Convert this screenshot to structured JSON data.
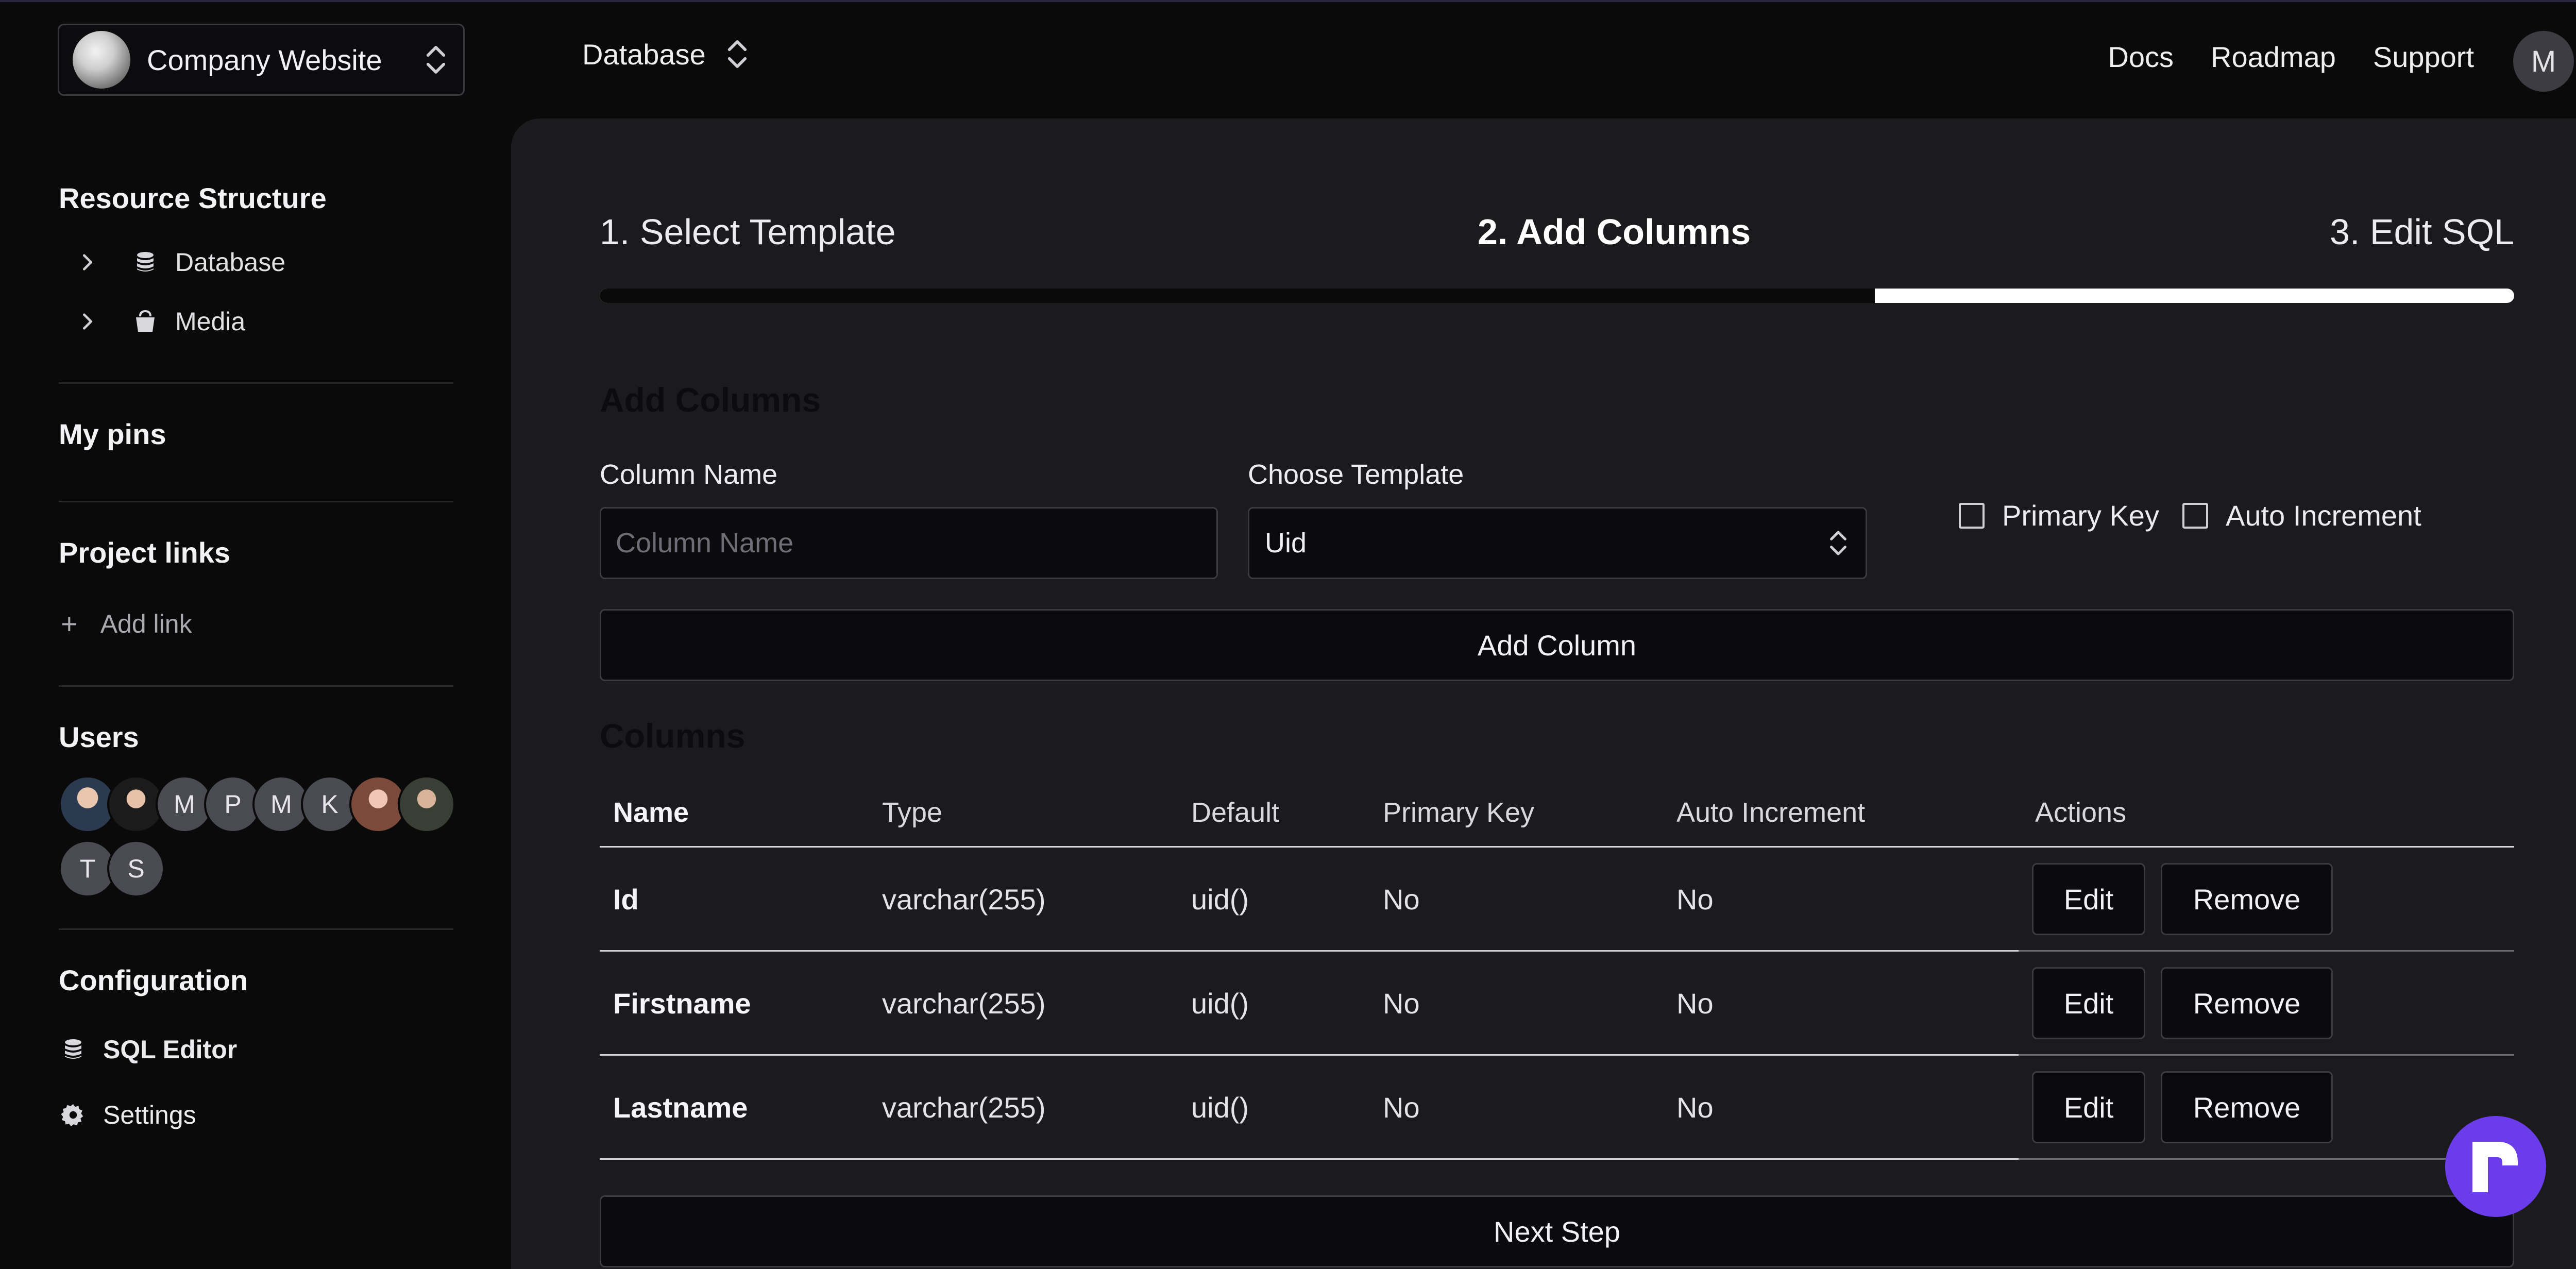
{
  "header": {
    "project_name": "Company Website",
    "database_label": "Database",
    "links": [
      "Docs",
      "Roadmap",
      "Support"
    ],
    "user_initial": "M"
  },
  "sidebar": {
    "resource_structure_title": "Resource Structure",
    "tree": [
      {
        "label": "Database",
        "icon": "database-icon"
      },
      {
        "label": "Media",
        "icon": "bucket-icon"
      }
    ],
    "my_pins_title": "My pins",
    "project_links_title": "Project links",
    "add_link_label": "Add link",
    "users_title": "Users",
    "users_row1": [
      "",
      "",
      "M",
      "P",
      "M",
      "K",
      "",
      ""
    ],
    "users_row2": [
      "T",
      "S"
    ],
    "configuration_title": "Configuration",
    "config_items": [
      {
        "label": "SQL Editor",
        "icon": "database-icon"
      },
      {
        "label": "Settings",
        "icon": "gear-icon"
      }
    ]
  },
  "wizard": {
    "steps": [
      "1. Select Template",
      "2. Add Columns",
      "3. Edit SQL"
    ],
    "active_step": 2,
    "progress_fraction": 0.666
  },
  "form": {
    "heading": "Add Columns",
    "column_name_label": "Column Name",
    "column_name_placeholder": "Column Name",
    "column_name_value": "",
    "template_label": "Choose Template",
    "template_value": "Uid",
    "primary_key_label": "Primary Key",
    "auto_increment_label": "Auto Increment",
    "add_column_button": "Add Column"
  },
  "columns_section": {
    "heading": "Columns",
    "headers": [
      "Name",
      "Type",
      "Default",
      "Primary Key",
      "Auto Increment",
      "Actions"
    ],
    "rows": [
      {
        "name": "Id",
        "type": "varchar(255)",
        "default": "uid()",
        "primary_key": "No",
        "auto_increment": "No"
      },
      {
        "name": "Firstname",
        "type": "varchar(255)",
        "default": "uid()",
        "primary_key": "No",
        "auto_increment": "No"
      },
      {
        "name": "Lastname",
        "type": "varchar(255)",
        "default": "uid()",
        "primary_key": "No",
        "auto_increment": "No"
      }
    ],
    "edit_label": "Edit",
    "remove_label": "Remove"
  },
  "footer": {
    "next_step_button": "Next Step"
  },
  "colors": {
    "accent": "#6b3dea",
    "panel": "#1b1b1e",
    "background": "#0a0a0b"
  }
}
